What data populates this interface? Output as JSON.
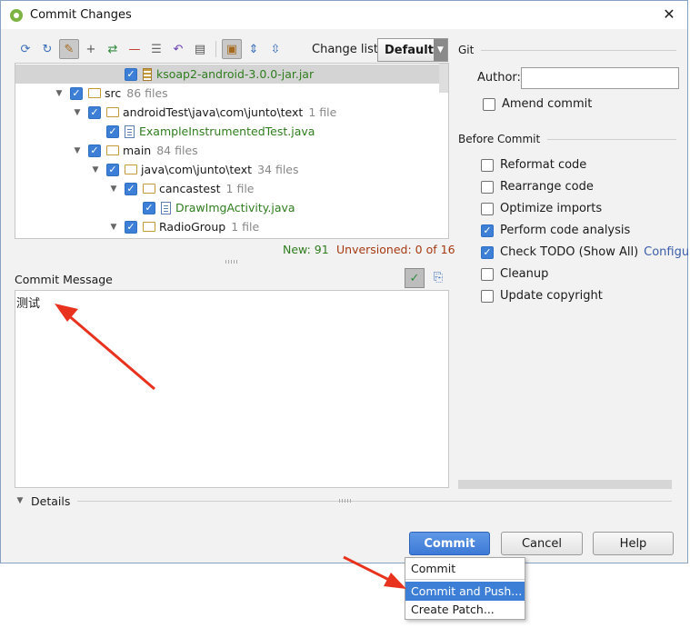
{
  "window": {
    "title": "Commit Changes"
  },
  "toolbar": {
    "icons": [
      "refresh-icon",
      "sync-icon",
      "show-diff-icon",
      "add-icon",
      "move-icon",
      "remove-icon",
      "group-icon",
      "revert-icon",
      "edit-source-icon",
      "folder-view-icon",
      "expand-all-icon",
      "collapse-all-icon"
    ],
    "changelist_label": "Change list:",
    "changelist_value": "Default"
  },
  "tree": {
    "rows": [
      {
        "depth": 4,
        "type": "jar",
        "name": "ksoap2-android-3.0.0-jar.jar",
        "count": "",
        "green": true,
        "expandable": false,
        "selected": true
      },
      {
        "depth": 1,
        "type": "folder",
        "name": "src",
        "count": "86 files",
        "green": false,
        "expandable": true,
        "selected": false
      },
      {
        "depth": 2,
        "type": "folder",
        "name": "androidTest\\java\\com\\junto\\text",
        "count": "1 file",
        "green": false,
        "expandable": true,
        "selected": false
      },
      {
        "depth": 3,
        "type": "file",
        "name": "ExampleInstrumentedTest.java",
        "count": "",
        "green": true,
        "expandable": false,
        "selected": false
      },
      {
        "depth": 2,
        "type": "folder",
        "name": "main",
        "count": "84 files",
        "green": false,
        "expandable": true,
        "selected": false
      },
      {
        "depth": 3,
        "type": "folder",
        "name": "java\\com\\junto\\text",
        "count": "34 files",
        "green": false,
        "expandable": true,
        "selected": false
      },
      {
        "depth": 4,
        "type": "folder",
        "name": "cancastest",
        "count": "1 file",
        "green": false,
        "expandable": true,
        "selected": false
      },
      {
        "depth": 5,
        "type": "file",
        "name": "DrawImgActivity.java",
        "count": "",
        "green": true,
        "expandable": false,
        "selected": false
      },
      {
        "depth": 4,
        "type": "folder",
        "name": "RadioGroup",
        "count": "1 file",
        "green": false,
        "expandable": true,
        "selected": false
      }
    ]
  },
  "stats": {
    "new": "New: 91",
    "unversioned": "Unversioned: 0 of 16"
  },
  "commit_message": {
    "label": "Commit Message",
    "value": "测试"
  },
  "details": {
    "label": "Details"
  },
  "git": {
    "header": "Git",
    "author_label": "Author:",
    "author_value": "",
    "amend_label": "Amend commit"
  },
  "before_commit": {
    "header": "Before Commit",
    "options": [
      {
        "label": "Reformat code",
        "checked": false
      },
      {
        "label": "Rearrange code",
        "checked": false
      },
      {
        "label": "Optimize imports",
        "checked": false
      },
      {
        "label": "Perform code analysis",
        "checked": true
      },
      {
        "label": "Check TODO (Show All)",
        "checked": true,
        "link": "Configure"
      },
      {
        "label": "Cleanup",
        "checked": false
      },
      {
        "label": "Update copyright",
        "checked": false
      }
    ]
  },
  "buttons": {
    "commit": "Commit",
    "cancel": "Cancel",
    "help": "Help"
  },
  "commit_menu": {
    "items": [
      "Commit",
      "Commit and Push...",
      "Create Patch..."
    ],
    "highlighted_index": 1
  },
  "colors": {
    "accent": "#3d7fd6",
    "new_files": "#2f7d1e",
    "unversioned": "#a53a12",
    "arrow": "#e8321e"
  }
}
